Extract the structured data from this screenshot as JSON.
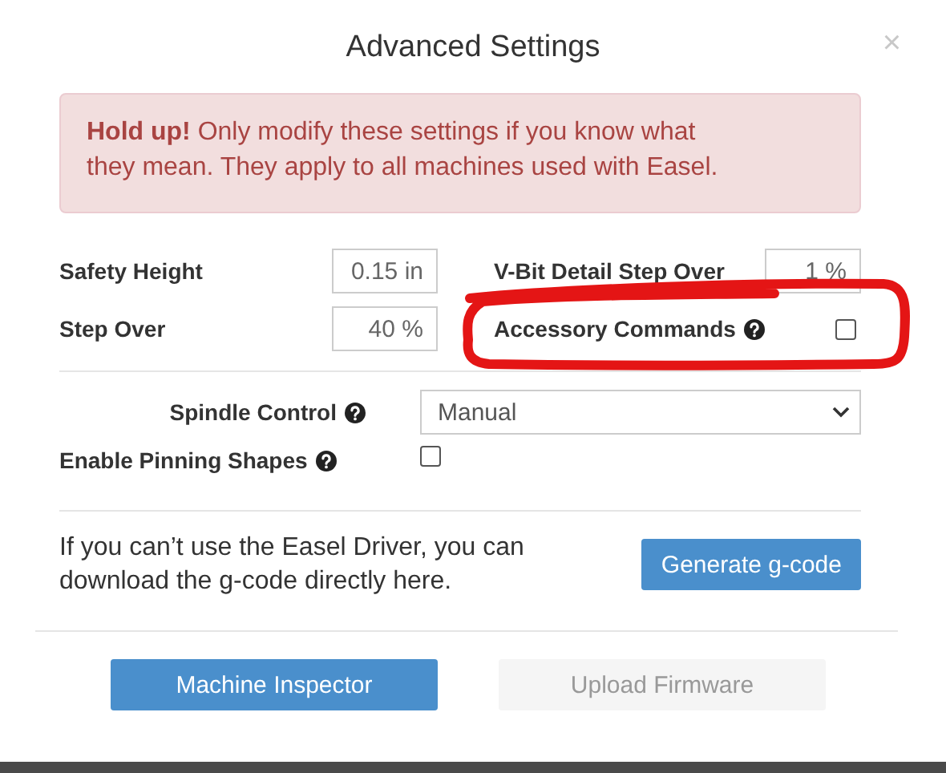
{
  "dialog": {
    "title": "Advanced Settings",
    "close": "×"
  },
  "alert": {
    "text": "**Hold up!** Only modify these settings if you know what they mean. They apply to all machines used with Easel."
  },
  "settings": [
    {
      "kind": "input",
      "label": "Safety Height",
      "value": "0.15 in"
    },
    {
      "kind": "input",
      "label": "V-Bit Detail Step Over",
      "value": "1 %"
    },
    {
      "kind": "input",
      "label": "Step Over",
      "value": "40 %"
    },
    {
      "kind": "checkbox",
      "label": "Accessory Commands",
      "help": true,
      "checked": false
    }
  ],
  "spindle_control": {
    "label": "Spindle Control",
    "help": true,
    "value": "Manual"
  },
  "pinning": {
    "label": "Enable Pinning Shapes",
    "help": true,
    "checked": false
  },
  "gcode": {
    "text": "If you can’t use the Easel Driver, you can download the g-code directly here.",
    "button": "Generate g-code"
  },
  "footer_buttons": [
    {
      "label": "Machine Inspector",
      "disabled": false
    },
    {
      "label": "Upload Firmware",
      "disabled": true
    }
  ],
  "annotation": {
    "kind": "freehand-loop"
  }
}
